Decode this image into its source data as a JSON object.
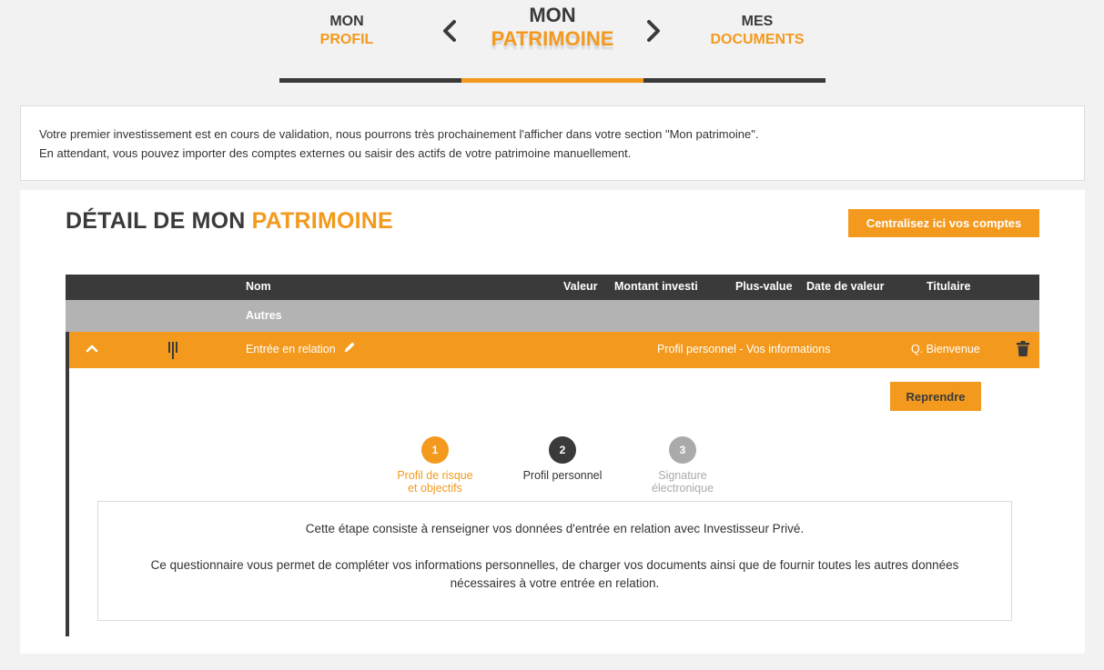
{
  "nav": {
    "left": {
      "w1": "MON",
      "w2": "PROFIL"
    },
    "center": {
      "w1": "MON",
      "w2": "PATRIMOINE"
    },
    "right": {
      "w1": "MES",
      "w2": "DOCUMENTS"
    }
  },
  "notice": {
    "line1": "Votre premier investissement est en cours de validation, nous pourrons très prochainement l'afficher dans votre section \"Mon patrimoine\".",
    "line2": "En attendant, vous pouvez importer des comptes externes ou saisir des actifs de votre patrimoine manuellement."
  },
  "panel": {
    "title_main": "DÉTAIL DE MON ",
    "title_accent": "PATRIMOINE",
    "cta_label": "Centralisez ici vos comptes"
  },
  "table": {
    "headers": {
      "nom": "Nom",
      "valeur": "Valeur",
      "montant": "Montant investi",
      "plusvalue": "Plus-value",
      "date": "Date de valeur",
      "titulaire": "Titulaire"
    },
    "group_label": "Autres",
    "row": {
      "name": "Entrée en relation",
      "status": "Profil personnel - Vos informations",
      "holder": "Q. Bienvenue"
    }
  },
  "detail": {
    "resume_label": "Reprendre",
    "steps": [
      {
        "num": "1",
        "label_l1": "Profil de risque",
        "label_l2": "et objectifs",
        "state": "done"
      },
      {
        "num": "2",
        "label_l1": "Profil personnel",
        "label_l2": "",
        "state": "current"
      },
      {
        "num": "3",
        "label_l1": "Signature",
        "label_l2": "électronique",
        "state": "todo"
      }
    ],
    "info_p1": "Cette étape consiste à renseigner vos données d'entrée en relation avec Investisseur Privé.",
    "info_p2": "Ce questionnaire vous permet de compléter vos informations personnelles, de charger vos documents ainsi que de fournir toutes les autres données nécessaires à votre entrée en relation."
  },
  "colors": {
    "accent": "#f39a1e",
    "dark": "#3a3a3a",
    "grey": "#b3b3b3"
  }
}
